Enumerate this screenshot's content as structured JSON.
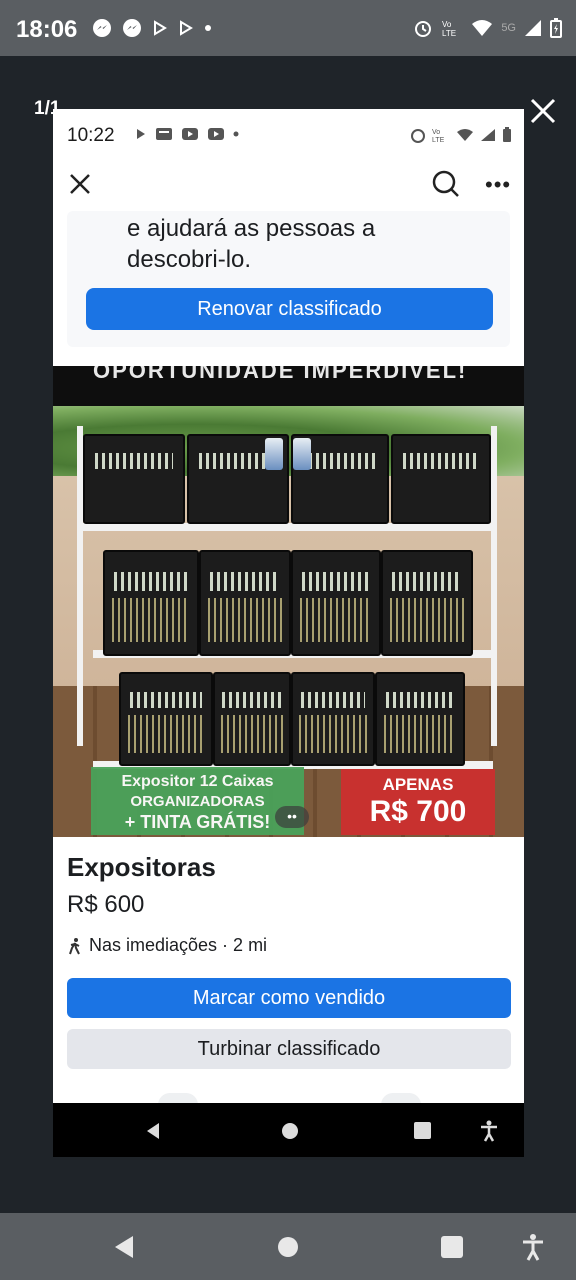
{
  "outer_status": {
    "time": "18:06",
    "left_icons": [
      "messenger-icon",
      "messenger-icon",
      "play-icon",
      "play-icon",
      "dot-icon"
    ],
    "right_icons": [
      "alarm-icon",
      "volte-icon",
      "wifi-icon",
      "signal-5g-icon",
      "battery-icon"
    ],
    "network_label": "5G"
  },
  "viewer": {
    "counter": "1/1"
  },
  "inner_status": {
    "time": "10:22",
    "left_icons": [
      "play-icon",
      "news-icon",
      "youtube-icon",
      "youtube-icon",
      "dot-icon"
    ],
    "right_icons": [
      "alarm-icon",
      "volte-icon",
      "wifi-icon",
      "signal-icon",
      "battery-icon"
    ]
  },
  "renew": {
    "text_line1": "e ajudará as pessoas a",
    "text_line2": "descobri-lo.",
    "button_label": "Renovar classificado"
  },
  "photo": {
    "banner_text": "OPORTUNIDADE IMPERDÍVEL!",
    "promo_green_line1": "Expositor 12 Caixas",
    "promo_green_line2": "ORGANIZADORAS",
    "promo_green_line3": "+ TINTA GRÁTIS!",
    "promo_red_line1": "APENAS",
    "promo_red_line2": "R$ 700",
    "more_dots": "••"
  },
  "listing": {
    "title": "Expositoras",
    "price": "R$ 600",
    "location": "Nas imediações · 2 mi",
    "mark_sold_label": "Marcar como vendido",
    "boost_label": "Turbinar classificado"
  },
  "colors": {
    "primary_blue": "#1b74e4",
    "secondary_gray": "#e4e6eb",
    "promo_green": "#4aa25a",
    "promo_red": "#c8312f"
  }
}
